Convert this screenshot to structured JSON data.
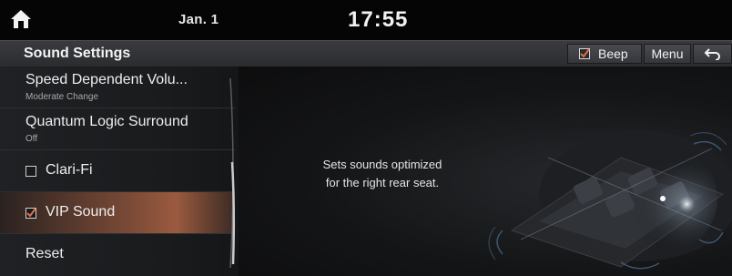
{
  "status": {
    "date": "Jan. 1",
    "time": "17:55"
  },
  "header": {
    "title": "Sound Settings",
    "beep_label": "Beep",
    "beep_checked": true,
    "menu_label": "Menu"
  },
  "list": {
    "items": [
      {
        "label": "Speed Dependent Volu...",
        "sub": "Moderate Change"
      },
      {
        "label": "Quantum Logic Surround",
        "sub": "Off"
      },
      {
        "label": "Clari-Fi",
        "checked": false
      },
      {
        "label": "VIP Sound",
        "checked": true,
        "selected": true
      },
      {
        "label": "Reset"
      }
    ]
  },
  "content": {
    "description_line1": "Sets sounds optimized",
    "description_line2": "for the right rear seat."
  },
  "icons": [
    "home-icon",
    "back-arrow-icon",
    "checkbox-icon",
    "car-speaker-illustration"
  ],
  "colors": {
    "accent_selection": "#9a5a3f",
    "check_mark": "#e0704a",
    "background": "#0b0b0c"
  }
}
